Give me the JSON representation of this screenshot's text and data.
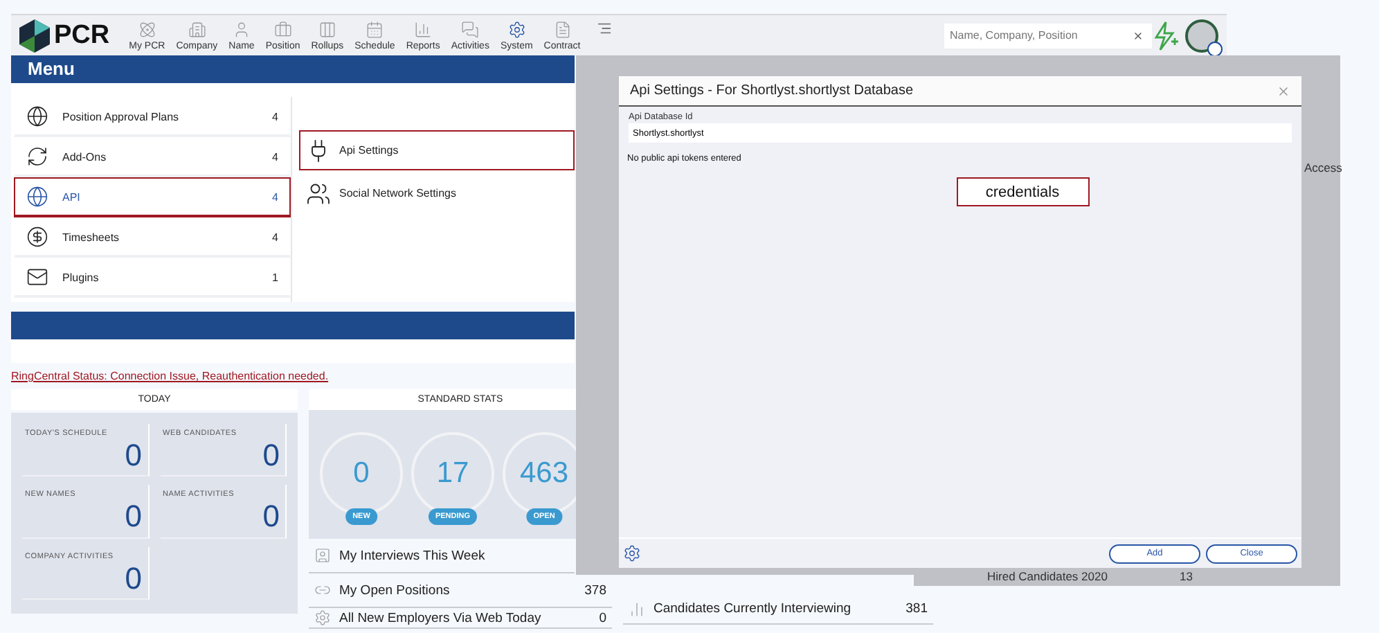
{
  "header": {
    "logo": "PCR",
    "nav": [
      {
        "label": "My PCR",
        "selected": false
      },
      {
        "label": "Company",
        "selected": false
      },
      {
        "label": "Name",
        "selected": false
      },
      {
        "label": "Position",
        "selected": false
      },
      {
        "label": "Rollups",
        "selected": false
      },
      {
        "label": "Schedule",
        "selected": false
      },
      {
        "label": "Reports",
        "selected": false
      },
      {
        "label": "Activities",
        "selected": false
      },
      {
        "label": "System",
        "selected": true
      },
      {
        "label": "Contract",
        "selected": false
      }
    ],
    "search": {
      "placeholder": "Name, Company, Position"
    }
  },
  "menu": {
    "title": "Menu",
    "items": [
      {
        "label": "Position Approval Plans",
        "count": "4",
        "selected": false,
        "highlighted": false
      },
      {
        "label": "Add-Ons",
        "count": "4",
        "selected": false,
        "highlighted": false
      },
      {
        "label": "API",
        "count": "4",
        "selected": true,
        "highlighted": true
      },
      {
        "label": "Timesheets",
        "count": "4",
        "selected": false,
        "highlighted": false
      },
      {
        "label": "Plugins",
        "count": "1",
        "selected": false,
        "highlighted": false
      }
    ],
    "subitems": [
      {
        "label": "Api Settings",
        "highlighted": true
      },
      {
        "label": "Social Network Settings",
        "highlighted": false
      }
    ]
  },
  "status_link": "RingCentral Status: Connection Issue, Reauthentication needed.",
  "today": {
    "title": "TODAY",
    "tiles": [
      {
        "label": "TODAY'S SCHEDULE",
        "value": "0"
      },
      {
        "label": "WEB CANDIDATES",
        "value": "0"
      },
      {
        "label": "NEW NAMES",
        "value": "0"
      },
      {
        "label": "NAME ACTIVITIES",
        "value": "0"
      },
      {
        "label": "COMPANY ACTIVITIES",
        "value": "0"
      }
    ]
  },
  "stats": {
    "title": "STANDARD STATS",
    "circles": [
      {
        "value": "0",
        "label": "NEW"
      },
      {
        "value": "17",
        "label": "PENDING"
      },
      {
        "value": "463",
        "label": "OPEN"
      }
    ],
    "rows": [
      {
        "label": "My Interviews This Week"
      },
      {
        "label": "My Open Positions",
        "count": "378"
      },
      {
        "label": "All New Employers Via Web Today",
        "count": "0"
      }
    ]
  },
  "extra_rows": [
    {
      "label": "Candidates Currently Interviewing",
      "count": "381"
    }
  ],
  "backdrop": {
    "access_text": "Access",
    "row": {
      "label": "Hired Candidates 2020",
      "count": "13"
    }
  },
  "dialog": {
    "title": "Api Settings - For Shortlyst.shortlyst Database",
    "field_label": "Api Database Id",
    "field_value": "Shortlyst.shortlyst",
    "message": "No public api tokens entered",
    "callout": "credentials",
    "buttons": [
      "Add",
      "Close"
    ]
  }
}
